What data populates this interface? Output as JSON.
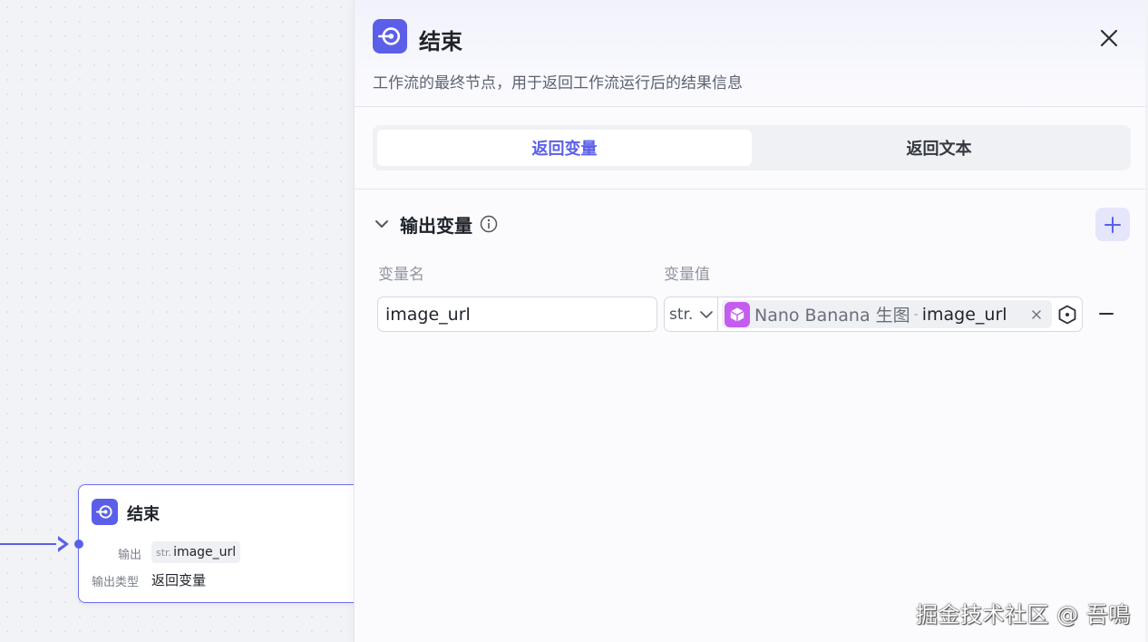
{
  "canvas": {
    "node": {
      "title": "结束",
      "output_label": "输出",
      "output_type_tag": "str.",
      "output_var": "image_url",
      "output_type_label": "输出类型",
      "output_type_value": "返回变量"
    }
  },
  "panel": {
    "title": "结束",
    "description": "工作流的最终节点，用于返回工作流运行后的结果信息",
    "tabs": [
      {
        "label": "返回变量",
        "active": true
      },
      {
        "label": "返回文本",
        "active": false
      }
    ],
    "section": {
      "title": "输出变量",
      "col_name": "变量名",
      "col_value": "变量值",
      "rows": [
        {
          "name": "image_url",
          "type": "str.",
          "ref_node": "Nano Banana 生图",
          "ref_sep": "-",
          "ref_var": "image_url"
        }
      ]
    }
  },
  "watermark": "掘金技术社区 @ 吾鳴",
  "colors": {
    "accent": "#5b5fe8",
    "ref_icon": "#c55cf0"
  },
  "icons": {
    "node_icon": "end-node-icon",
    "close": "close-icon",
    "collapse": "chevron-down-icon",
    "info": "info-icon",
    "add": "plus-icon",
    "remove": "minus-icon",
    "ref": "cube-icon",
    "picker": "variable-picker-icon"
  }
}
